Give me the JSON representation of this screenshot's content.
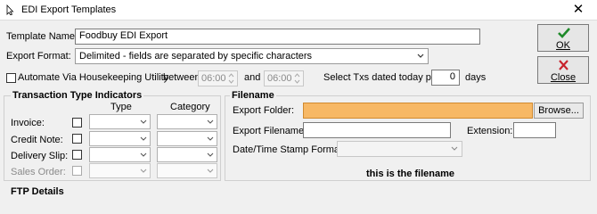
{
  "window": {
    "title": "EDI Export Templates",
    "close_glyph": "✕"
  },
  "form": {
    "template_name_label": "Template Name:",
    "template_name_value": "Foodbuy EDI Export",
    "export_format_label": "Export Format:",
    "export_format_value": "Delimited - fields are separated by specific characters"
  },
  "buttons": {
    "ok": "OK",
    "close": "Close"
  },
  "housekeeping": {
    "label": "Automate Via Housekeeping Utility",
    "between_label": "between",
    "start_time": "06:00",
    "and_label": "and",
    "end_time": "06:00",
    "select_label": "Select Txs dated today plus",
    "days_value": "0",
    "days_label": "days"
  },
  "tti": {
    "title": "Transaction Type Indicators",
    "type_header": "Type",
    "category_header": "Category",
    "rows": [
      {
        "label": "Invoice:",
        "enabled": true
      },
      {
        "label": "Credit Note:",
        "enabled": true
      },
      {
        "label": "Delivery Slip:",
        "enabled": true
      },
      {
        "label": "Sales Order:",
        "enabled": false
      }
    ]
  },
  "filename": {
    "title": "Filename",
    "export_folder_label": "Export Folder:",
    "export_folder_value": "",
    "browse_label": "Browse...",
    "export_filename_label": "Export Filename:",
    "export_filename_value": "",
    "extension_label": "Extension:",
    "extension_value": "",
    "datetime_label": "Date/Time Stamp Format:",
    "preview_text": "this is the filename"
  },
  "ftp": {
    "title": "FTP Details"
  },
  "colors": {
    "folder_highlight": "#f7b865",
    "ok_check": "#1f8a2a",
    "close_x": "#c8232c"
  }
}
